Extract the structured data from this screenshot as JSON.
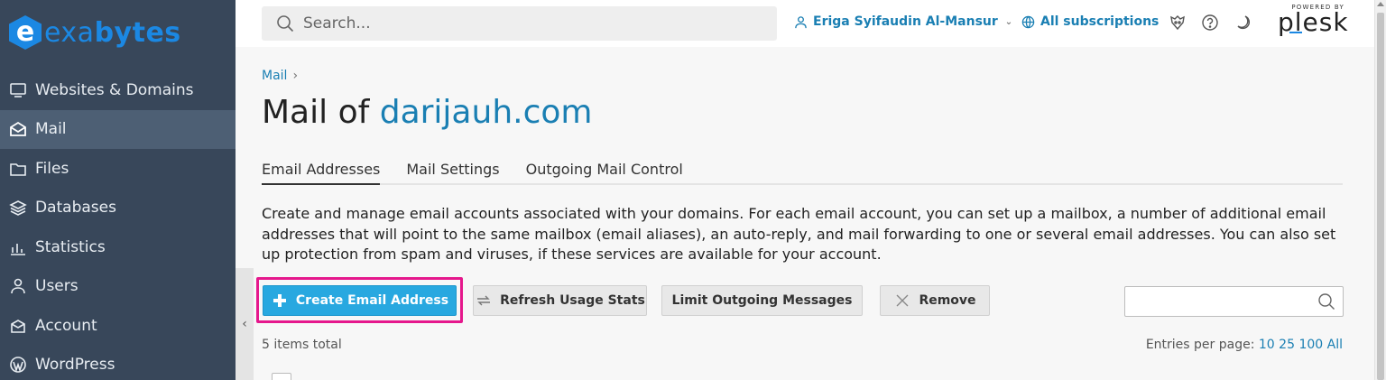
{
  "brand": {
    "mark": "e",
    "text_a": "exa",
    "text_b": "bytes"
  },
  "sidebar": {
    "items": [
      {
        "label": "Websites & Domains",
        "icon": "monitor-icon"
      },
      {
        "label": "Mail",
        "icon": "envelope-icon",
        "active": true
      },
      {
        "label": "Files",
        "icon": "folder-icon"
      },
      {
        "label": "Databases",
        "icon": "database-icon"
      },
      {
        "label": "Statistics",
        "icon": "bar-chart-icon"
      },
      {
        "label": "Users",
        "icon": "user-icon"
      },
      {
        "label": "Account",
        "icon": "account-icon"
      },
      {
        "label": "WordPress",
        "icon": "wordpress-icon"
      }
    ],
    "collapse_glyph": "‹"
  },
  "header": {
    "search_placeholder": "Search...",
    "user_name": "Eriga Syifaudin Al-Mansur",
    "subscriptions": "All subscriptions",
    "powered_by": "POWERED BY",
    "plesk": "plesk"
  },
  "breadcrumb": {
    "item": "Mail",
    "sep": "›"
  },
  "page": {
    "title_prefix": "Mail of ",
    "domain": "darijauh.com"
  },
  "tabs": [
    "Email Addresses",
    "Mail Settings",
    "Outgoing Mail Control"
  ],
  "description": "Create and manage email accounts associated with your domains. For each email account, you can set up a mailbox, a number of additional email addresses that will point to the same mailbox (email aliases), an auto-reply, and mail forwarding to one or several email addresses. You can also set up protection from spam and viruses, if these services are available for your account.",
  "toolbar": {
    "create": "Create Email Address",
    "refresh": "Refresh Usage Stats",
    "limit": "Limit Outgoing Messages",
    "remove": "Remove"
  },
  "list": {
    "total": "5 items total",
    "entries_label": "Entries per page: ",
    "entries_options": [
      "10",
      "25",
      "100",
      "All"
    ]
  },
  "colors": {
    "accent": "#1a7fb3",
    "primary_button": "#28a8e0",
    "highlight": "#e5178c",
    "sidebar": "#38475a"
  }
}
